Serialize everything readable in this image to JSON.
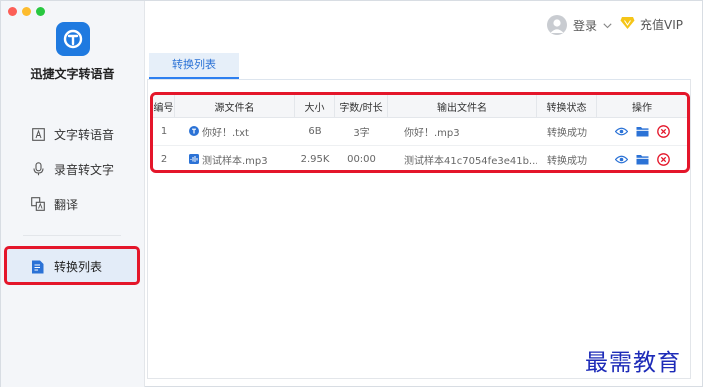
{
  "app": {
    "name": "迅捷文字转语音"
  },
  "sidebar": {
    "items": [
      {
        "label": "文字转语音",
        "icon": "text-to-speech-icon"
      },
      {
        "label": "录音转文字",
        "icon": "microphone-icon"
      },
      {
        "label": "翻译",
        "icon": "translate-icon"
      },
      {
        "label": "转换列表",
        "icon": "conversion-list-icon",
        "active": true
      }
    ]
  },
  "header": {
    "login_label": "登录",
    "vip_label": "充值VIP"
  },
  "tabs": [
    {
      "label": "转换列表"
    }
  ],
  "table": {
    "columns": [
      "编号",
      "源文件名",
      "大小",
      "字数/时长",
      "输出文件名",
      "转换状态",
      "操作"
    ],
    "rows": [
      {
        "no": "1",
        "source": "你好！.txt",
        "source_icon": "text-file-icon",
        "size": "6B",
        "length": "3字",
        "output": "你好！.mp3",
        "status": "转换成功"
      },
      {
        "no": "2",
        "source": "测试样本.mp3",
        "source_icon": "audio-file-icon",
        "size": "2.95K",
        "length": "00:00",
        "output": "测试样本41c7054fe3e41b...",
        "status": "转换成功"
      }
    ]
  },
  "watermark": "最需教育",
  "colors": {
    "accent": "#2d7ff0",
    "highlight": "#e4162a",
    "logo": "#1f7ae0",
    "vip": "#f5c518"
  }
}
